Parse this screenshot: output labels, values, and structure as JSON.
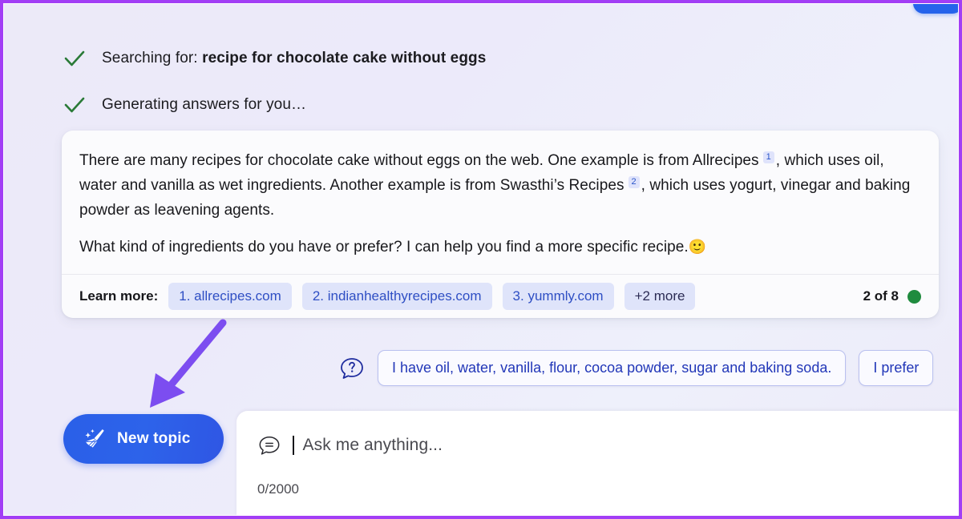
{
  "status": {
    "items": [
      {
        "icon": "check-icon",
        "prefix": "Searching for: ",
        "query": "recipe for chocolate cake without eggs"
      },
      {
        "icon": "check-icon",
        "prefix": "Generating answers for you…",
        "query": ""
      }
    ]
  },
  "answer": {
    "paragraph1_a": "There are many recipes for chocolate cake without eggs on the web. One example is from Allrecipes",
    "cite1": "1",
    "paragraph1_b": ", which uses oil, water and vanilla as wet ingredients. Another example is from Swasthi’s Recipes",
    "cite2": "2",
    "paragraph1_c": ", which uses yogurt, vinegar and baking powder as leavening agents.",
    "paragraph2": "What kind of ingredients do you have or prefer? I can help you find a more specific recipe.",
    "paragraph2_emoji": "🙂",
    "footer": {
      "learn_more_label": "Learn more:",
      "sources": [
        "1. allrecipes.com",
        "2. indianhealthyrecipes.com",
        "3. yummly.com",
        "+2 more"
      ],
      "counter_text": "2 of 8",
      "counter_dot_color": "#1f8b3e"
    }
  },
  "suggestions": {
    "help_icon": "question-bubble-icon",
    "chips": [
      "I have oil, water, vanilla, flour, cocoa powder, sugar and baking soda.",
      "I prefer"
    ]
  },
  "new_topic": {
    "icon": "broom-icon",
    "label": "New topic"
  },
  "composer": {
    "icon": "chat-bubble-icon",
    "placeholder": "Ask me anything...",
    "char_count": "0/2000"
  },
  "theme": {
    "accent_blue": "#2d63ea",
    "chip_blue": "#2f4fc4",
    "chip_bg": "#dfe4fa",
    "check_green": "#2a7a37",
    "annotation_purple": "#7c4df0",
    "page_border": "#a23ef5"
  }
}
